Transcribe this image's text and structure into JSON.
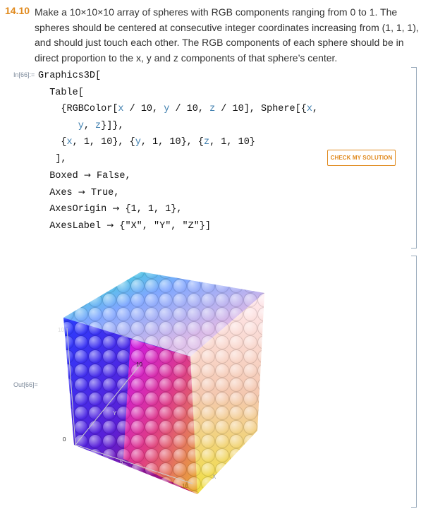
{
  "exercise": {
    "number": "14.10",
    "text": "Make a 10×10×10 array of spheres with RGB components ranging from 0 to 1. The spheres should be centered at consecutive integer coordinates increasing from (1, 1, 1), and should just touch each other. The RGB components of each sphere should be in direct proportion to the x, y and z components of that sphere’s center."
  },
  "cell": {
    "input_label": "In[66]:=",
    "output_label": "Out[66]=",
    "check_button_label": "CHECK MY SOLUTION"
  },
  "code": {
    "head": "Graphics3D[",
    "table": "Table[",
    "rgb_open": "{RGBColor[",
    "x1": "x",
    "div10a": " / 10, ",
    "y1": "y",
    "div10b": " / 10, ",
    "z1": "z",
    "div10c": " / 10], Sphere[{",
    "x2": "x",
    "comma1": ",",
    "y2": "y",
    "comma2": ", ",
    "z2": "z",
    "close1": "}]},",
    "it_open1": "{",
    "it_x": "x",
    "it_rest1": ", 1, 10}, {",
    "it_y": "y",
    "it_rest2": ", 1, 10}, {",
    "it_z": "z",
    "it_rest3": ", 1, 10}",
    "table_close": "],",
    "boxed_key": "Boxed ",
    "boxed_val": " False,",
    "axes_key": "Axes ",
    "axes_val": " True,",
    "origin_key": "AxesOrigin ",
    "origin_val": " {1, 1, 1},",
    "label_key": "AxesLabel ",
    "label_val": " {\"X\", \"Y\", \"Z\"}]",
    "arrow": "→"
  },
  "axes": {
    "ticks": [
      "10",
      "10",
      "0",
      "5",
      "10"
    ],
    "labels": [
      "Y",
      "X"
    ]
  },
  "colors": {
    "accent": "#e08a1e",
    "code_var": "#3f7faf",
    "label_gray": "#7d8a9a"
  }
}
